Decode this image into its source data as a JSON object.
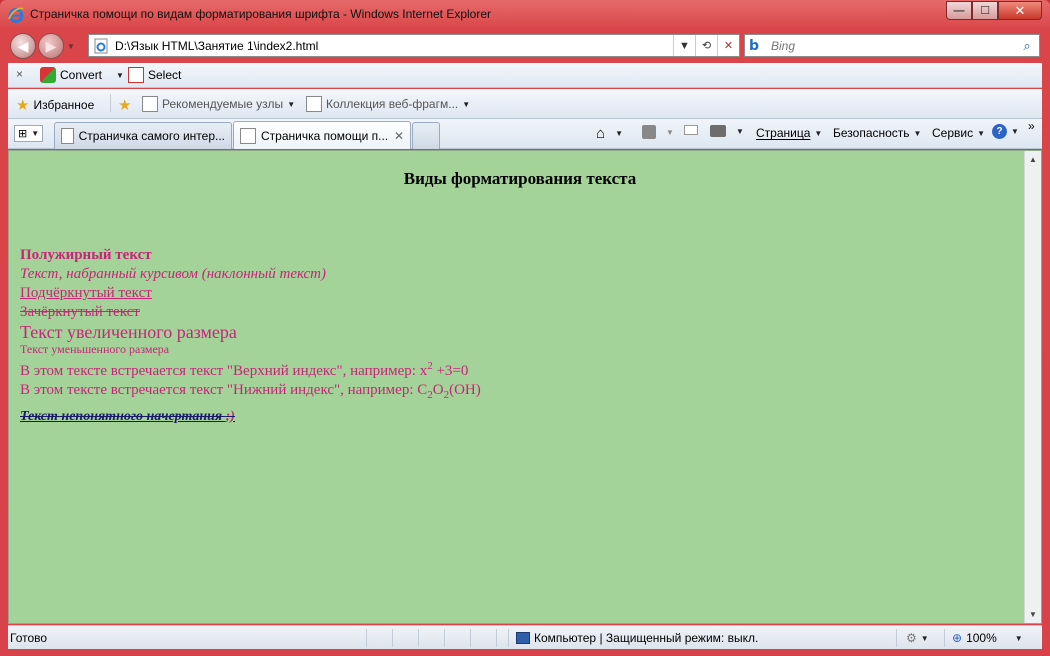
{
  "window": {
    "title": "Страничка помощи по видам форматирования шрифта - Windows Internet Explorer",
    "minimize": "—",
    "maximize": "☐",
    "close": "✕"
  },
  "nav": {
    "address": "D:\\Язык HTML\\Занятие 1\\index2.html",
    "search_placeholder": "Bing"
  },
  "toolbar1": {
    "close": "×",
    "convert_label": "Convert",
    "select_label": "Select"
  },
  "favorites": {
    "label": "Избранное",
    "recommended": "Рекомендуемые узлы",
    "webslices": "Коллекция веб-фрагм..."
  },
  "tabs": [
    {
      "label": "Страничка самого интер..."
    },
    {
      "label": "Страничка помощи п..."
    }
  ],
  "commands": {
    "page": "Страница",
    "safety": "Безопасность",
    "tools": "Сервис",
    "more": "»"
  },
  "content": {
    "heading": "Виды форматирования текста",
    "bold": "Полужирный текст",
    "italic": "Текст, набранный курсивом (наклонный текст)",
    "underline": "Подчёркнутый текст",
    "strike": "Зачёркнутый текст",
    "big": "Текст увеличенного размера",
    "small": "Текст уменьшенного размера",
    "sup_prefix": "В этом тексте встречается текст \"Верхний индекс\", например: x",
    "sup_value": "2",
    "sup_suffix": " +3=0",
    "sub_prefix": "В этом тексте встречается текст \"Нижний индекс\", например: C",
    "sub_1": "2",
    "sub_mid": "O",
    "sub_2": "2",
    "sub_suffix": "(OH)",
    "odd": "Текст непонятного начертания ",
    "smile": ";)"
  },
  "status": {
    "ready": "Готово",
    "zone": "Компьютер | Защищенный режим: выкл.",
    "zoom": "100%"
  },
  "colors": {
    "page_bg": "#a4d399",
    "text": "#c8247a",
    "frame": "#d8424a"
  }
}
